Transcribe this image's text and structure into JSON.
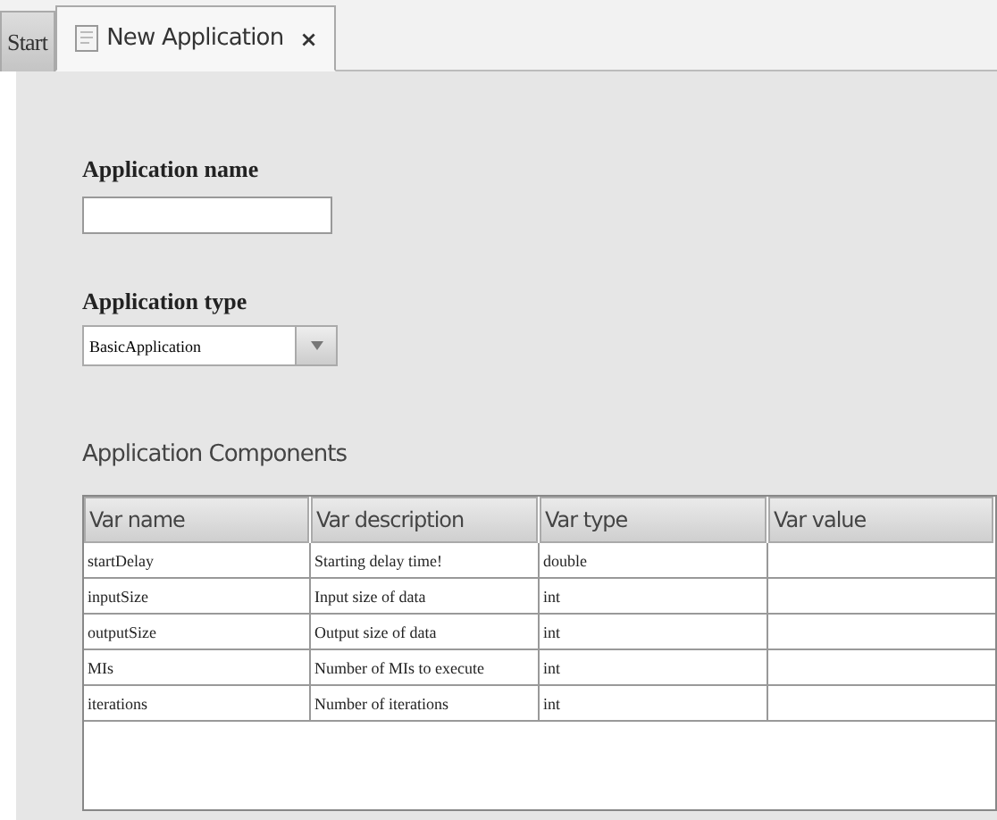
{
  "tabs": [
    {
      "label": "Start",
      "selected": false
    },
    {
      "label": "New Application",
      "selected": true,
      "close": "×"
    }
  ],
  "form": {
    "name_label": "Application name",
    "type_label": "Application type",
    "type_value": "BasicApplication"
  },
  "components": {
    "title": "Application Components",
    "columns": [
      "Var name",
      "Var description",
      "Var type",
      "Var value"
    ],
    "rows": [
      [
        "startDelay",
        "Starting delay time!",
        "double",
        ""
      ],
      [
        "inputSize",
        "Input size of data",
        "int",
        ""
      ],
      [
        "outputSize",
        "Output size of data",
        "int",
        ""
      ],
      [
        "MIs",
        "Number of MIs to execute",
        "int",
        ""
      ],
      [
        "iterations",
        "Number of iterations",
        "int",
        ""
      ]
    ]
  }
}
